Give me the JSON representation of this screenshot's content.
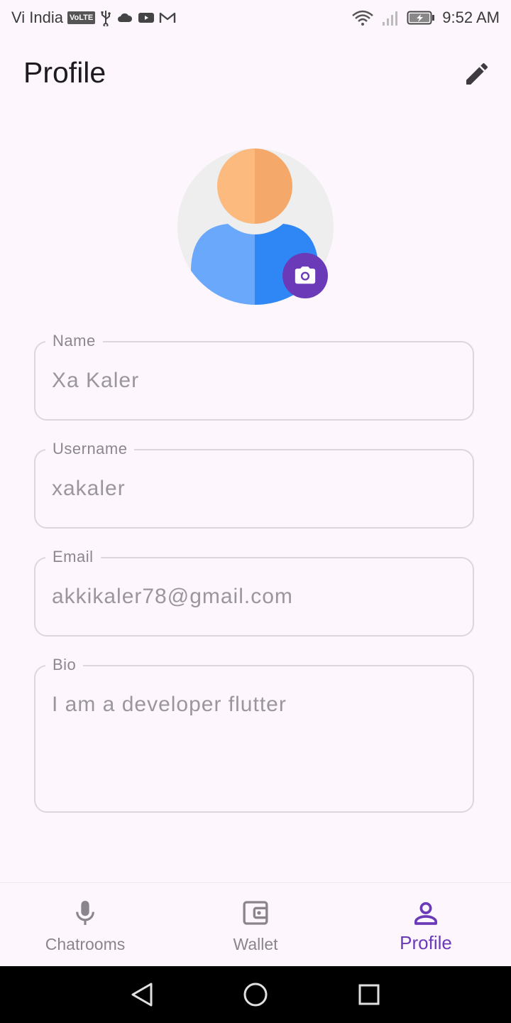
{
  "status_bar": {
    "carrier": "Vi India",
    "volte_badge": "VoLTE",
    "time": "9:52 AM",
    "icons_left": [
      "usb-icon",
      "cloud-icon",
      "youtube-icon",
      "gmail-icon"
    ],
    "icons_right": [
      "wifi-icon",
      "signal-icon",
      "battery-charging-icon"
    ]
  },
  "app_bar": {
    "title": "Profile",
    "edit_icon": "pencil-icon"
  },
  "avatar": {
    "icon": "person-avatar-icon",
    "camera_icon": "camera-icon",
    "colors": {
      "background": "#eeeeee",
      "head_light": "#fdba7f",
      "head_dark": "#f4a96b",
      "body_light": "#6aa8fb",
      "body_dark": "#2f86f5",
      "camera_bg": "#6a3ab8"
    }
  },
  "form": {
    "name": {
      "label": "Name",
      "value": "Xa Kaler"
    },
    "username": {
      "label": "Username",
      "value": "xakaler"
    },
    "email": {
      "label": "Email",
      "value": "akkikaler78@gmail.com"
    },
    "bio": {
      "label": "Bio",
      "value": "I am a developer flutter"
    }
  },
  "bottom_nav": {
    "items": [
      {
        "label": "Chatrooms",
        "icon": "microphone-icon",
        "active": false
      },
      {
        "label": "Wallet",
        "icon": "wallet-icon",
        "active": false
      },
      {
        "label": "Profile",
        "icon": "person-icon",
        "active": true
      }
    ],
    "active_color": "#6a3ab8"
  },
  "system_nav": {
    "icons": [
      "back-triangle-icon",
      "home-circle-icon",
      "recents-square-icon"
    ]
  }
}
